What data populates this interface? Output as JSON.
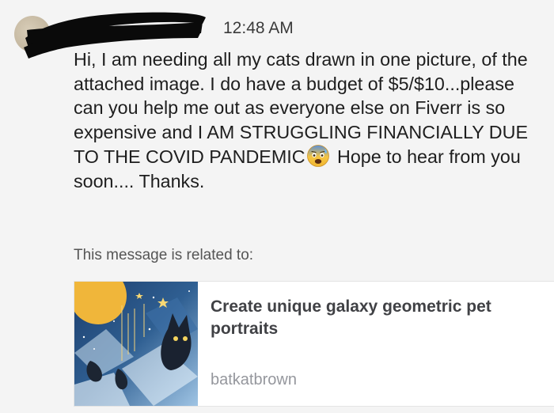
{
  "message_header": {
    "username": "",
    "timestamp": "12:48 AM"
  },
  "message": {
    "text_before_emoji": "Hi, I am needing all my cats drawn in one picture, of the attached image. I do have a budget of $5/$10...please can you help me out as everyone else on Fiverr is so expensive and I AM STRUGGLING FINANCIALLY DUE TO THE COVID PANDEMIC",
    "emoji_icon": "anxious-face-with-sweat-icon",
    "text_after_emoji": " Hope to hear from you soon.... Thanks."
  },
  "related": {
    "label": "This message is related to:",
    "gig": {
      "title": "Create unique galaxy geometric pet portraits",
      "seller": "batkatbrown",
      "thumbnail_icon": "galaxy-cat-artwork-thumbnail"
    }
  },
  "colors": {
    "background": "#f4f4f4",
    "card_background": "#ffffff",
    "seller_text": "#95979d",
    "redaction": "#0a0a0a"
  }
}
